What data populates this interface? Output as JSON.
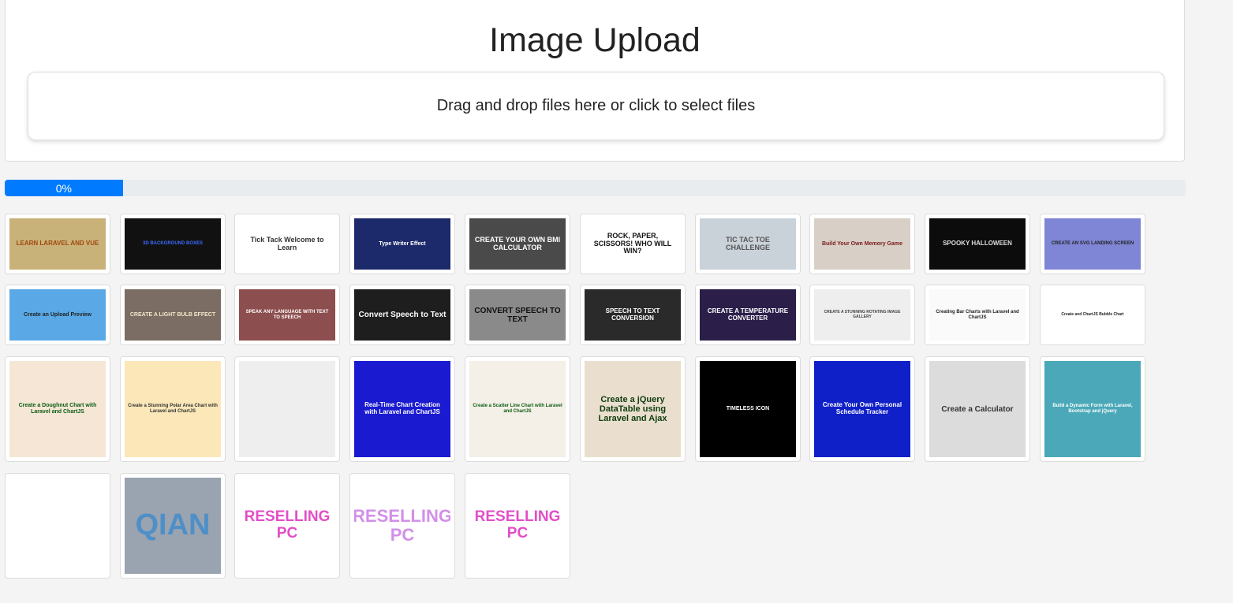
{
  "header": {
    "title": "Image Upload"
  },
  "dropzone": {
    "label": "Drag and drop files here or click to select files"
  },
  "progress": {
    "label": "0%",
    "fill_fraction": 0.1
  },
  "thumbnails": [
    {
      "text": "LEARN LARAVEL AND VUE",
      "bg": "#c9b27a",
      "fg": "#a0480a",
      "size": 8
    },
    {
      "text": "3D BACKGROUND BOXES",
      "bg": "#111111",
      "fg": "#3b6cff",
      "size": 6
    },
    {
      "text": "Tick Tack Welcome to Learn",
      "bg": "#ffffff",
      "fg": "#333333",
      "size": 9
    },
    {
      "text": "Type Writer Effect",
      "bg": "#1c2a6b",
      "fg": "#ffffff",
      "size": 7
    },
    {
      "text": "CREATE YOUR OWN BMI CALCULATOR",
      "bg": "#4a4a4a",
      "fg": "#ffffff",
      "size": 9
    },
    {
      "text": "ROCK, PAPER, SCISSORS! WHO WILL WIN?",
      "bg": "#ffffff",
      "fg": "#111111",
      "size": 9
    },
    {
      "text": "TIC TAC TOE CHALLENGE",
      "bg": "#c9d1d9",
      "fg": "#555555",
      "size": 9
    },
    {
      "text": "Build Your Own Memory Game",
      "bg": "#d8cfc7",
      "fg": "#7a1b1b",
      "size": 7
    },
    {
      "text": "SPOOKY HALLOWEEN",
      "bg": "#0c0c0c",
      "fg": "#dddddd",
      "size": 8
    },
    {
      "text": "CREATE AN SVG LANDING SCREEN",
      "bg": "#7f86d6",
      "fg": "#222222",
      "size": 6
    },
    {
      "text": "Create an Upload Preview",
      "bg": "#5aa9e6",
      "fg": "#222222",
      "size": 7
    },
    {
      "text": "CREATE A LIGHT BULB EFFECT",
      "bg": "#7b6d63",
      "fg": "#f5e6c8",
      "size": 7
    },
    {
      "text": "SPEAK ANY LANGUAGE WITH TEXT TO SPEECH",
      "bg": "#8c4e4e",
      "fg": "#ffffff",
      "size": 6
    },
    {
      "text": "Convert Speech to Text",
      "bg": "#1e1e1e",
      "fg": "#ffffff",
      "size": 10
    },
    {
      "text": "CONVERT SPEECH TO TEXT",
      "bg": "#8a8a8a",
      "fg": "#111111",
      "size": 10
    },
    {
      "text": "SPEECH TO TEXT CONVERSION",
      "bg": "#2a2a2a",
      "fg": "#ffffff",
      "size": 8
    },
    {
      "text": "CREATE A TEMPERATURE CONVERTER",
      "bg": "#2b1f4a",
      "fg": "#ffffff",
      "size": 8
    },
    {
      "text": "CREATE A STUNNING ROTATING IMAGE GALLERY",
      "bg": "#eeeeee",
      "fg": "#444444",
      "size": 5
    },
    {
      "text": "Creating Bar Charts with Laravel and ChartJS",
      "bg": "#fafafa",
      "fg": "#222222",
      "size": 6
    },
    {
      "text": "Create and ChartJS Bubble Chart",
      "bg": "#ffffff",
      "fg": "#222222",
      "size": 5
    },
    {
      "text": "Create a Doughnut Chart with Laravel and ChartJS",
      "bg": "#f5e6d6",
      "fg": "#0a5d12",
      "size": 7
    },
    {
      "text": "Create a Stunning Polar Area Chart with Laravel and ChartJS",
      "bg": "#fbe7b8",
      "fg": "#333333",
      "size": 6
    },
    {
      "text": "",
      "bg": "#eeeeee",
      "fg": "#333333",
      "size": 6
    },
    {
      "text": "Real-Time Chart Creation with Laravel and ChartJS",
      "bg": "#1a1ad0",
      "fg": "#ffffff",
      "size": 8
    },
    {
      "text": "Create a Scatter Line Chart with Laravel and ChartJS",
      "bg": "#f4efe7",
      "fg": "#0a5d12",
      "size": 6
    },
    {
      "text": "Create a jQuery DataTable using Laravel and Ajax",
      "bg": "#eadfce",
      "fg": "#0f3d0f",
      "size": 11
    },
    {
      "text": "TIMELESS ICON",
      "bg": "#000000",
      "fg": "#ffffff",
      "size": 7
    },
    {
      "text": "Create Your Own Personal Schedule Tracker",
      "bg": "#1020c8",
      "fg": "#ffffff",
      "size": 8
    },
    {
      "text": "Create a Calculator",
      "bg": "#dcdcdc",
      "fg": "#333333",
      "size": 10
    },
    {
      "text": "Build a Dynamic Form with Laravel, Bootstrap and jQuery",
      "bg": "#4aa8b8",
      "fg": "#ffffff",
      "size": 6
    },
    {
      "text": "",
      "bg": "#ffffff",
      "fg": "#333333",
      "size": 6
    },
    {
      "text": "QIAN",
      "bg": "#9aa4b0",
      "fg": "#4f8fc7",
      "size": 38
    },
    {
      "text": "RESELLING PC",
      "bg": "#ffffff",
      "fg": "#e24ec7",
      "size": 19
    },
    {
      "text": "RESELLING PC",
      "bg": "#ffffff",
      "fg": "#d28fe8",
      "size": 22
    },
    {
      "text": "RESELLING PC",
      "bg": "#ffffff",
      "fg": "#e24ec7",
      "size": 19
    }
  ]
}
